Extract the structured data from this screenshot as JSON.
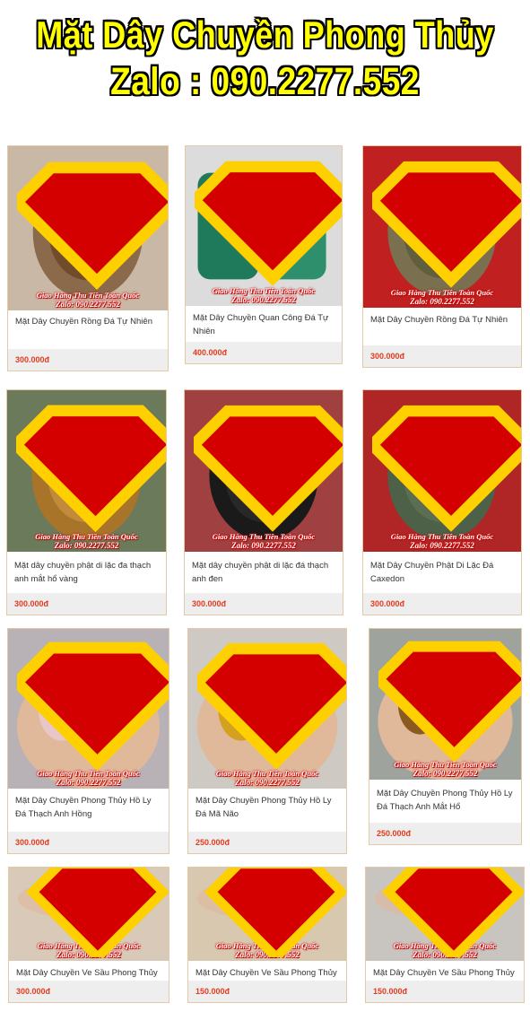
{
  "banner": {
    "title": "Mặt Dây Chuyền Phong Thủy",
    "contact": "Zalo : 090.2277.552"
  },
  "watermark": {
    "line1": "Giao Hàng Thu Tiền Toàn Quốc",
    "line2": "Zalo: 090.2277.552"
  },
  "colors": {
    "banner_text": "#ffff00",
    "price": "#e23c1f",
    "card_border": "#e3c9a6",
    "price_bar": "#eeeeee"
  },
  "products": [
    {
      "name": "Mặt Dây Chuyền Rồng Đá Tự Nhiên",
      "price": "300.000đ",
      "image": "tiger-eye-dragon-pendant-in-hand"
    },
    {
      "name": "Mặt Dây Chuyền Quan Công Đá Tự Nhiên",
      "price": "400.000đ",
      "image": "green-jade-guan-gong-pendants"
    },
    {
      "name": "Mặt Dây Chuyền Rồng Đá Tự Nhiên",
      "price": "300.000đ",
      "image": "round-dragon-stone-pendant-on-cord"
    },
    {
      "name": "Mặt dây chuyền phật di lặc đa thạch anh mắt hổ vàng",
      "price": "300.000đ",
      "image": "tiger-eye-buddha-pendant"
    },
    {
      "name": "Mặt dây chuyền phật di lặc đá thạch anh đen",
      "price": "300.000đ",
      "image": "black-obsidian-buddha-pendant"
    },
    {
      "name": "Mặt Dây Chuyền Phật Di Lặc Đá Caxedon",
      "price": "300.000đ",
      "image": "green-chalcedony-buddha-on-cord"
    },
    {
      "name": "Mặt Dây Chuyền Phong Thủy Hồ Ly Đá Thạch Anh Hồng",
      "price": "300.000đ",
      "image": "rose-quartz-fox-pendants-in-hand"
    },
    {
      "name": "Mặt Dây Chuyền Phong Thủy Hồ Ly Đá Mã Não",
      "price": "250.000đ",
      "image": "agate-fox-pendants-in-hand"
    },
    {
      "name": "Mặt Dây Chuyền Phong Thủy Hồ Ly Đá Thạch Anh Mắt Hổ",
      "price": "250.000đ",
      "image": "tiger-eye-fox-pendants-in-hand"
    },
    {
      "name": "Mặt Dây Chuyền Ve Sầu Phong Thủy Đá Tự Nhiên",
      "price": "300.000đ",
      "image": "cicada-pendants-in-hand"
    },
    {
      "name": "Mặt Dây Chuyền Ve Sầu Phong Thủy Đá Tự Nhiên",
      "price": "150.000đ",
      "image": "yellow-cicada-pendant"
    },
    {
      "name": "Mặt Dây Chuyền Ve Sầu Phong Thủy",
      "price": "150.000đ",
      "image": "white-cicada-pendants"
    }
  ]
}
